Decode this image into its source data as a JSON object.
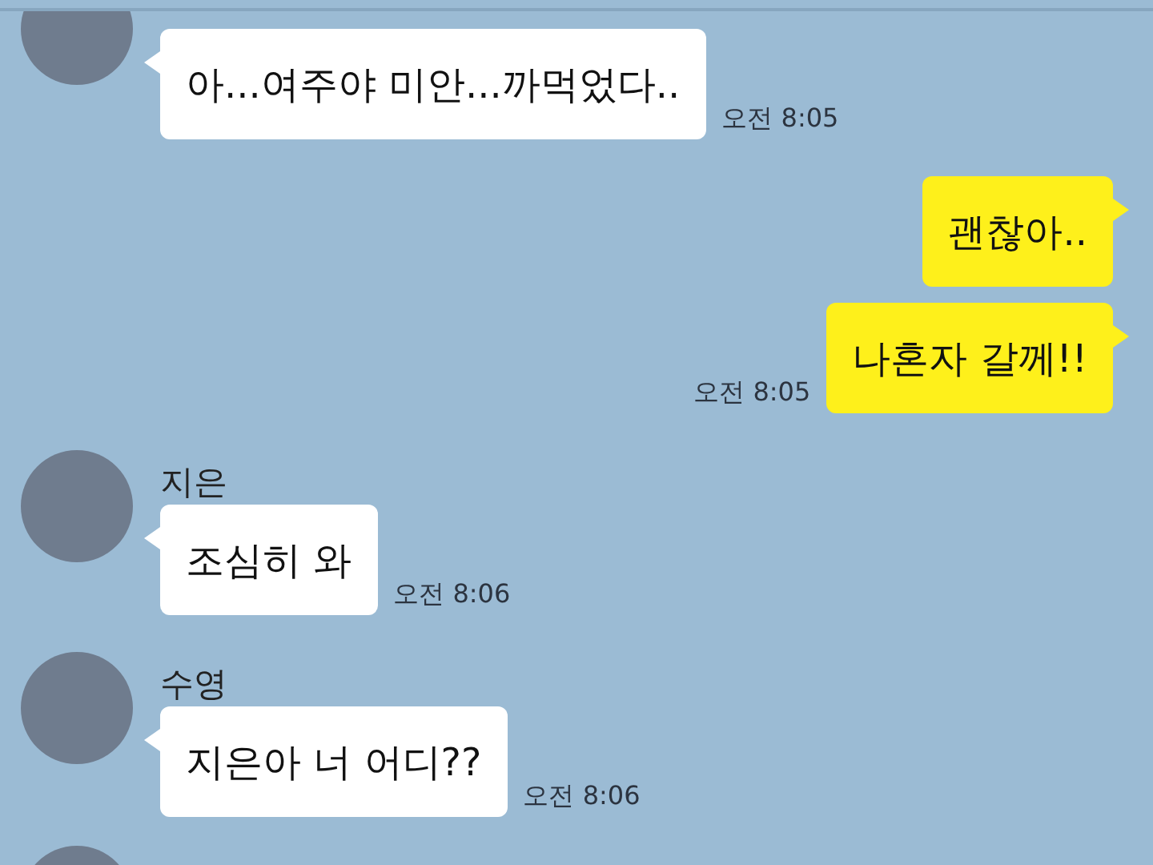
{
  "messages": [
    {
      "kind": "incoming",
      "avatar": true,
      "text": "아...여주야 미안...까먹었다..",
      "time": "오전 8:05"
    },
    {
      "kind": "outgoing",
      "text": "괜찮아.."
    },
    {
      "kind": "outgoing",
      "text": "나혼자 갈께!!",
      "time": "오전 8:05"
    },
    {
      "kind": "incoming",
      "avatar": true,
      "name": "지은",
      "text": "조심히 와",
      "time": "오전 8:06"
    },
    {
      "kind": "incoming",
      "avatar": true,
      "name": "수영",
      "text": "지은아 너 어디??",
      "time": "오전 8:06"
    },
    {
      "kind": "avatar-only",
      "avatar": true
    }
  ]
}
